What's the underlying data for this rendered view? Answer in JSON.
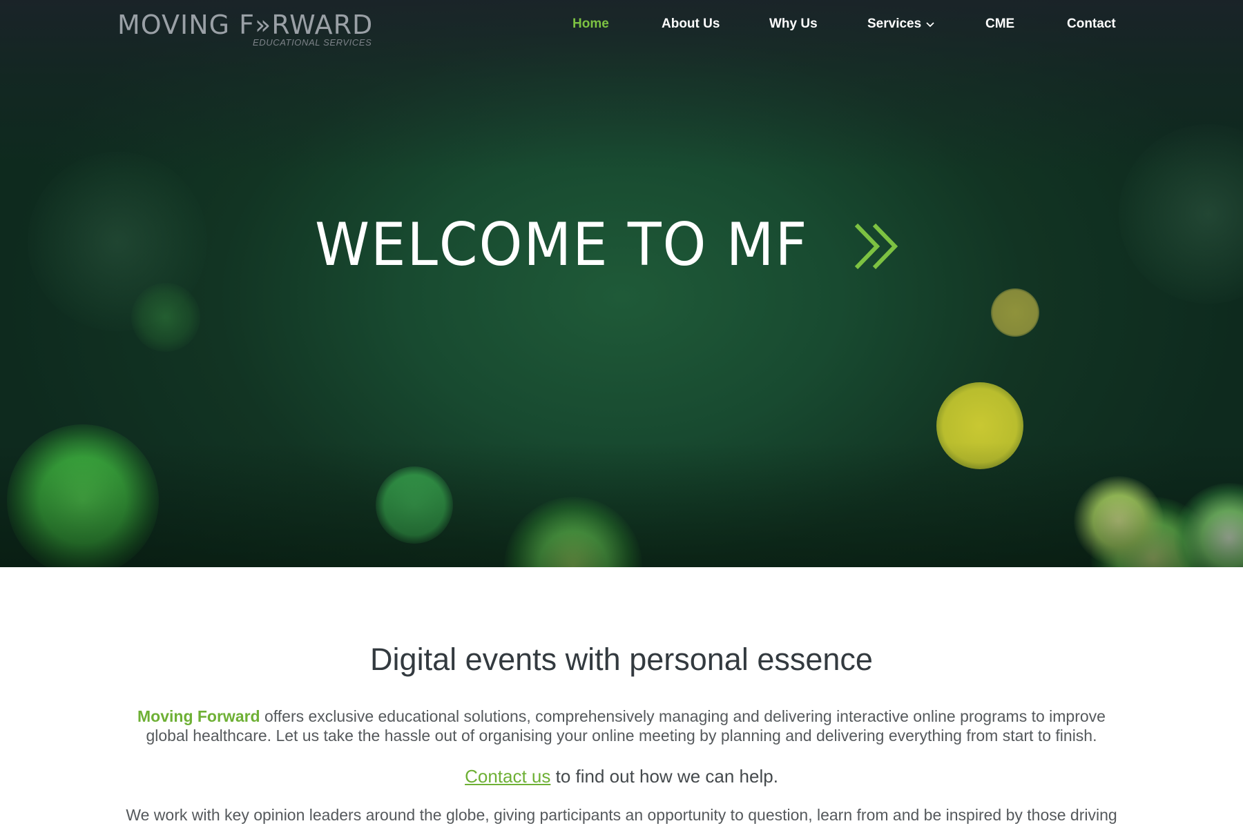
{
  "logo": {
    "main_text_left": "MOVING F",
    "main_text_chev": "»",
    "main_text_right": "RWARD",
    "subtitle": "EDUCATIONAL SERVICES"
  },
  "nav": {
    "items": [
      {
        "label": "Home",
        "active": true
      },
      {
        "label": "About Us"
      },
      {
        "label": "Why Us"
      },
      {
        "label": "Services",
        "has_dropdown": true,
        "icon": "chevron-down-icon"
      },
      {
        "label": "CME"
      },
      {
        "label": "Contact"
      }
    ],
    "active_color": "#7dc242"
  },
  "hero": {
    "title": "WELCOME TO MF",
    "title_icon": "double-chevron-right-icon",
    "accent_color": "#7dc242"
  },
  "content": {
    "heading": "Digital events with personal essence",
    "brand_name": "Moving Forward",
    "intro_text": " offers exclusive educational solutions, comprehensively managing and delivering interactive online programs to improve global healthcare. Let us take the hassle out of organising your online meeting by planning and delivering everything from start to finish.",
    "cta_link": "Contact us",
    "cta_rest": " to find out how we can help.",
    "para2": "We work with key opinion leaders around the globe, giving participants an opportunity to question, learn from and be inspired by those driving"
  }
}
